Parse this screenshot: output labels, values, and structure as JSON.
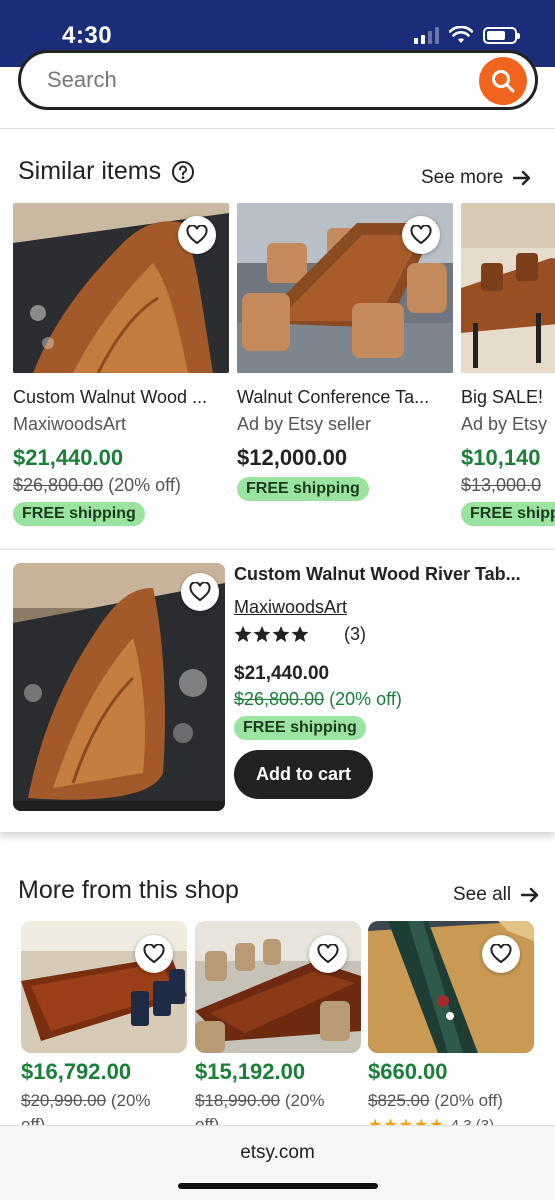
{
  "status": {
    "time": "4:30"
  },
  "search": {
    "placeholder": "Search"
  },
  "similar": {
    "title": "Similar items",
    "see_more": "See more",
    "items": [
      {
        "title": "Custom Walnut Wood ...",
        "sub": "MaxiwoodsArt",
        "price": "$21,440.00",
        "orig": "$26,800.00",
        "discount": "(20% off)",
        "shipping": "FREE shipping"
      },
      {
        "title": "Walnut Conference Ta...",
        "sub": "Ad by Etsy seller",
        "price": "$12,000.00",
        "shipping": "FREE shipping"
      },
      {
        "title": "Big SALE!",
        "sub": "Ad by Etsy",
        "price": "$10,140",
        "orig": "$13,000.0",
        "shipping": "FREE shipp"
      }
    ]
  },
  "featured": {
    "title": "Custom Walnut Wood River Tab...",
    "shop": "MaxiwoodsArt",
    "rating_value": 4.5,
    "review_count": "(3)",
    "price": "$21,440.00",
    "orig": "$26,800.00",
    "discount": "(20% off)",
    "shipping": "FREE shipping",
    "add_to_cart": "Add to cart"
  },
  "more": {
    "title": "More from this shop",
    "see_all": "See all",
    "items": [
      {
        "price": "$16,792.00",
        "orig": "$20,990.00",
        "discount": "(20%",
        "discount2": "off)"
      },
      {
        "price": "$15,192.00",
        "orig": "$18,990.00",
        "discount": "(20%",
        "discount2": "off)"
      },
      {
        "price": "$660.00",
        "orig": "$825.00",
        "discount": "(20% off)",
        "rating": "4.3 (3)"
      }
    ]
  },
  "browser": {
    "domain": "etsy.com"
  },
  "colors": {
    "accent": "#f1641e",
    "status_bar": "#1b2d78",
    "sale_green": "#1a7f37",
    "shipping_badge": "#9be3a0"
  }
}
